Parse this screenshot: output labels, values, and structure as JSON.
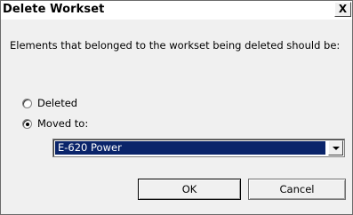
{
  "window": {
    "title": "Delete Workset",
    "close_label": "X"
  },
  "message": "Elements that belonged to the workset being deleted should be:",
  "options": [
    {
      "label": "Deleted",
      "checked": false
    },
    {
      "label": "Moved to:",
      "checked": true
    }
  ],
  "target_workset": {
    "selected": "E-620 Power"
  },
  "buttons": {
    "ok": "OK",
    "cancel": "Cancel"
  },
  "colors": {
    "selection_background": "#0a246a",
    "dialog_background": "#f0f0f0"
  }
}
